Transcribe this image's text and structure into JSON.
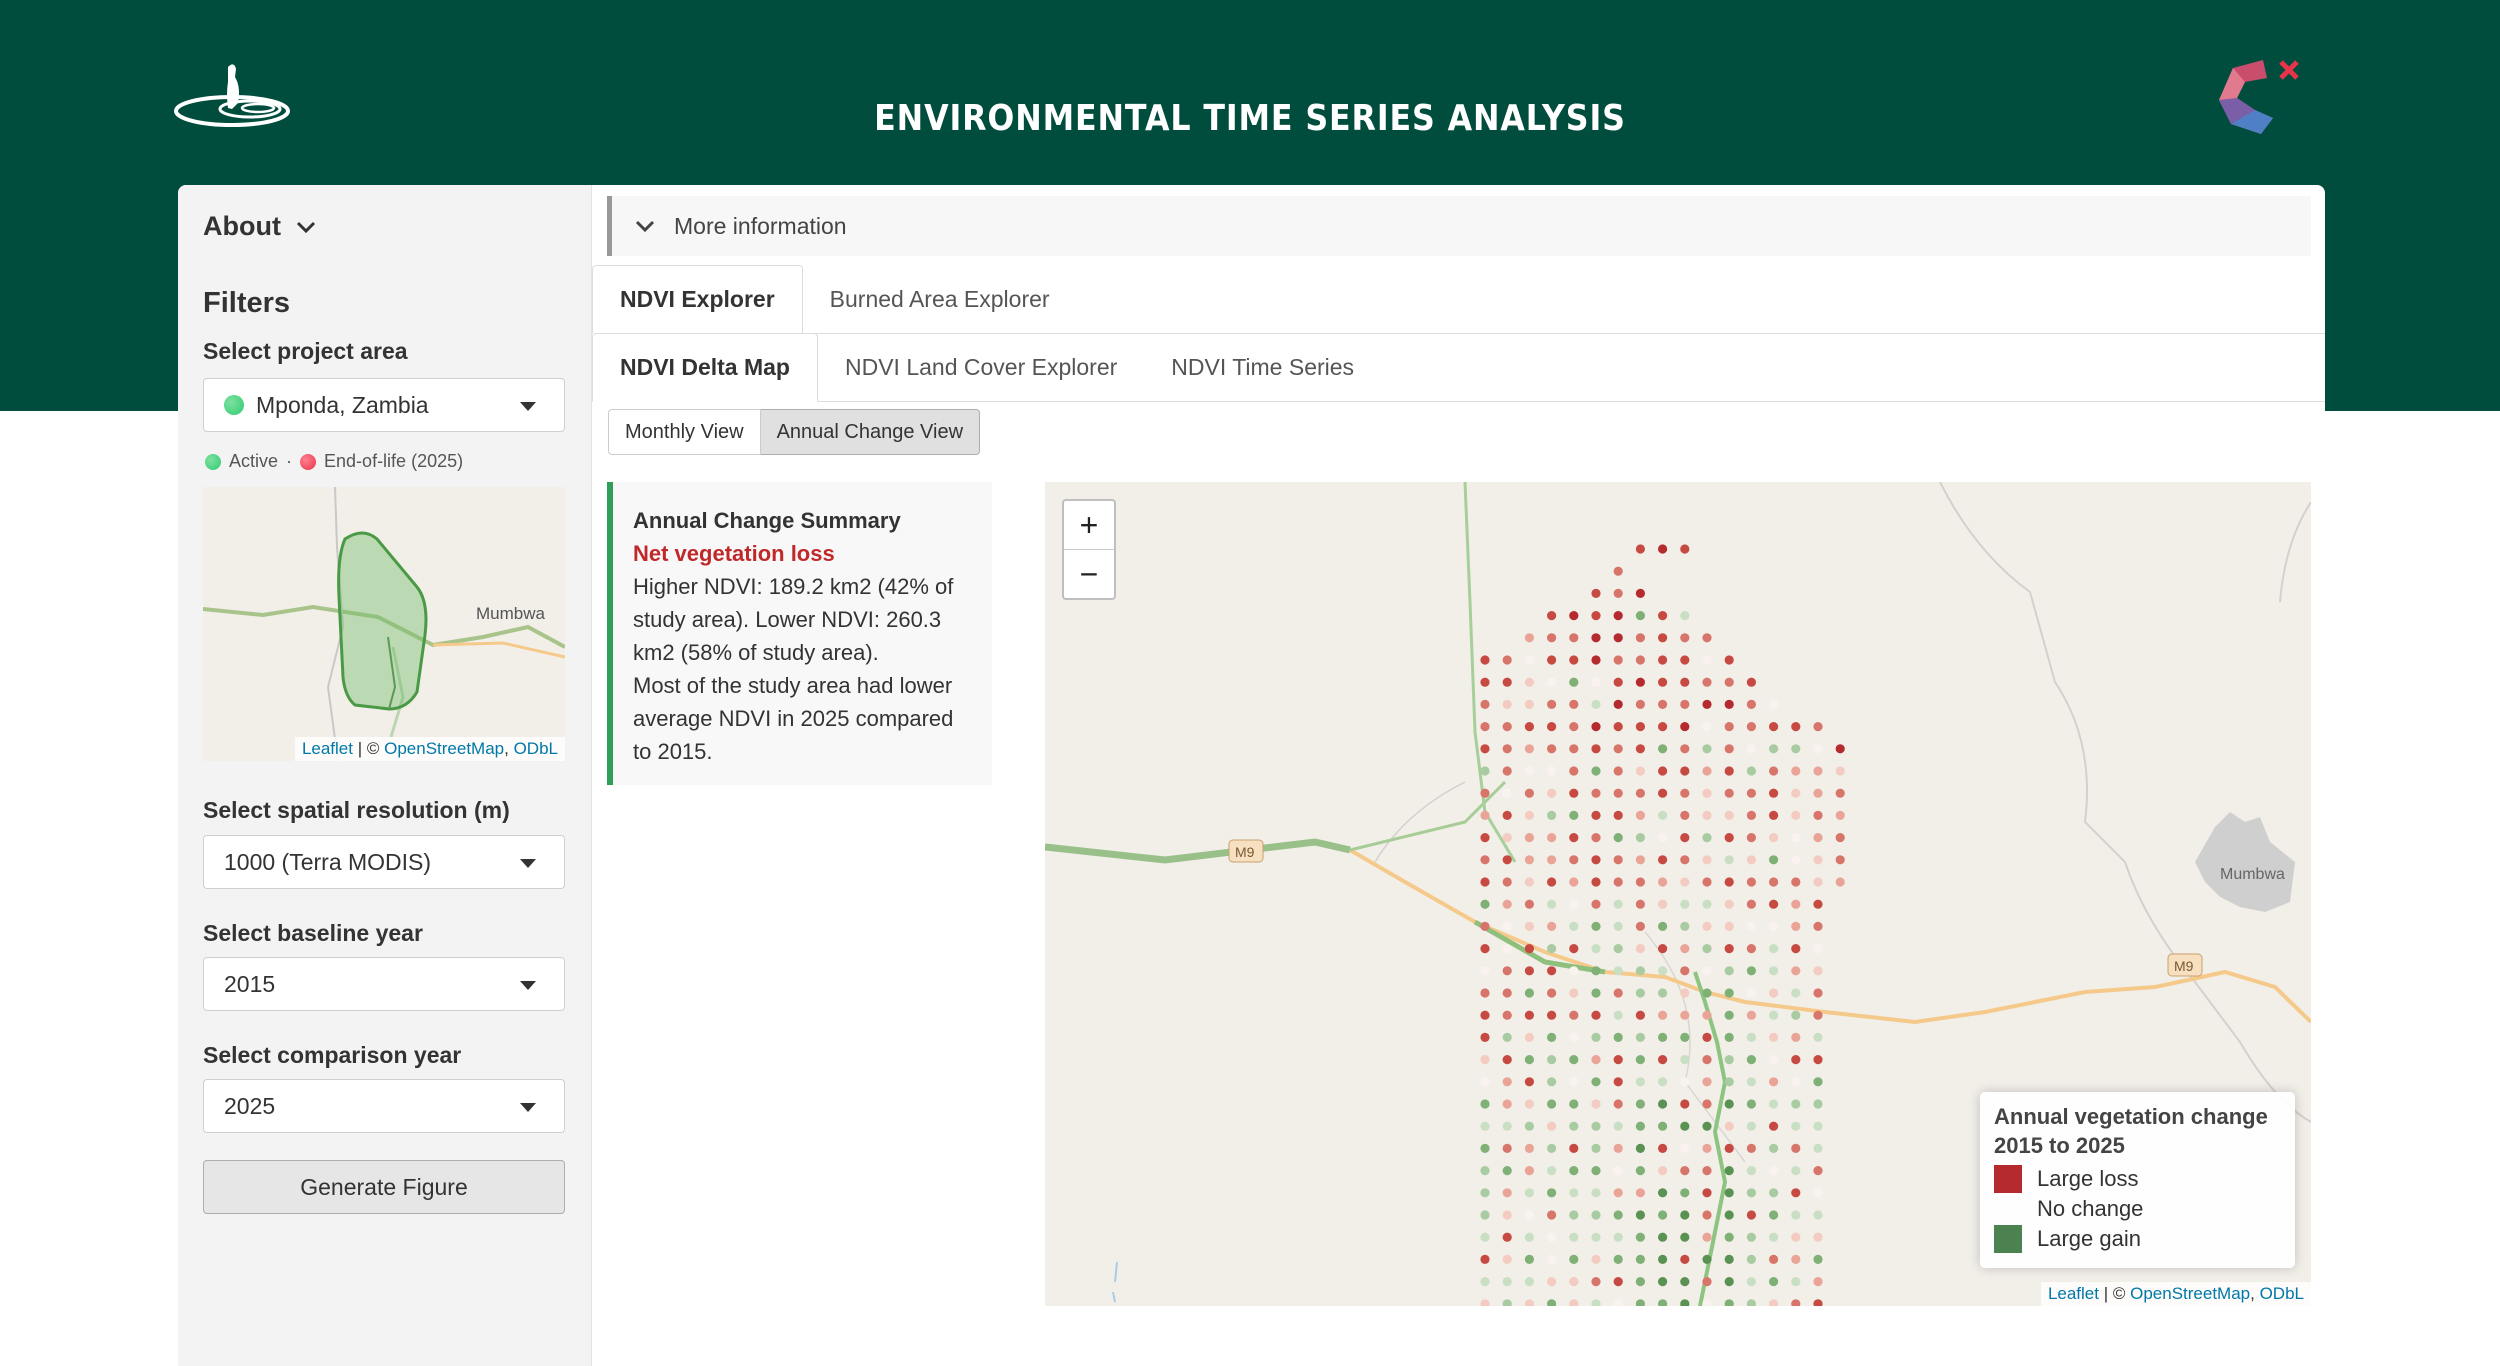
{
  "app": {
    "title": "ENVIRONMENTAL TIME SERIES ANALYSIS"
  },
  "colors": {
    "header": "#004d3d",
    "loss": "#b52a2e",
    "gain": "#4c8250",
    "active": "#2ecc71",
    "eol": "#e8334a",
    "accent_bar": "#2e9e58"
  },
  "icons": {
    "left_logo": "meerkat-logo-icon",
    "right_logo": "c-polygon-logo-icon"
  },
  "sidebar": {
    "about_label": "About",
    "filters_heading": "Filters",
    "project_area": {
      "label": "Select project area",
      "value": "Mponda, Zambia"
    },
    "status_legend": {
      "active": "Active",
      "separator": "·",
      "eol": "End-of-life (2025)"
    },
    "minimap": {
      "place": "Mumbwa",
      "attribution": {
        "leaflet": "Leaflet",
        "separator": " | © ",
        "osm": "OpenStreetMap",
        "comma": ", ",
        "odbl": "ODbL"
      }
    },
    "resolution": {
      "label": "Select spatial resolution (m)",
      "value": "1000 (Terra MODIS)"
    },
    "baseline": {
      "label": "Select baseline year",
      "value": "2015"
    },
    "comparison": {
      "label": "Select comparison year",
      "value": "2025"
    },
    "generate_label": "Generate Figure"
  },
  "main": {
    "more_info_label": "More information",
    "top_tabs": [
      {
        "label": "NDVI Explorer"
      },
      {
        "label": "Burned Area Explorer"
      }
    ],
    "sub_tabs": [
      {
        "label": "NDVI Delta Map"
      },
      {
        "label": "NDVI Land Cover Explorer"
      },
      {
        "label": "NDVI Time Series"
      }
    ],
    "view_buttons": [
      {
        "label": "Monthly View"
      },
      {
        "label": "Annual Change View"
      }
    ],
    "summary": {
      "title": "Annual Change Summary",
      "status": "Net vegetation loss",
      "line1": "Higher NDVI: 189.2 km2 (42% of study area). Lower NDVI: 260.3 km2 (58% of study area).",
      "line2": "Most of the study area had lower average NDVI in 2025 compared to 2015."
    },
    "map": {
      "zoom_in": "+",
      "zoom_out": "−",
      "road_label": "M9",
      "town": "Mumbwa",
      "legend": {
        "title": "Annual vegetation change 2015 to 2025",
        "loss": "Large loss",
        "none": "No change",
        "gain": "Large gain"
      },
      "attribution": {
        "leaflet": "Leaflet",
        "separator": " | © ",
        "osm": "OpenStreetMap",
        "comma": ", ",
        "odbl": "ODbL"
      }
    }
  }
}
